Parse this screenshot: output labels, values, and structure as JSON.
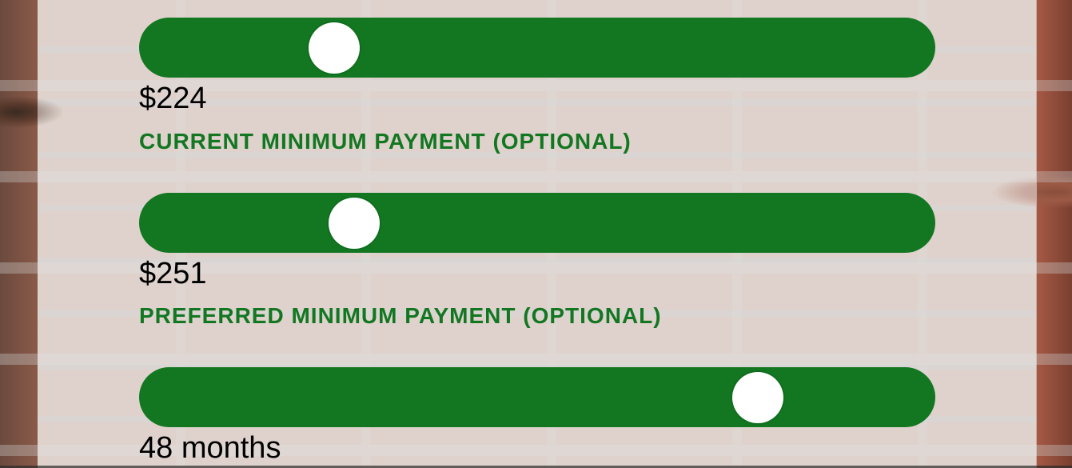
{
  "colors": {
    "accent": "#137722",
    "thumb": "#ffffff",
    "text": "#000000"
  },
  "sliders": [
    {
      "value_text": "$224",
      "fraction": 0.245,
      "label": "CURRENT MINIMUM PAYMENT (OPTIONAL)"
    },
    {
      "value_text": "$251",
      "fraction": 0.27,
      "label": "PREFERRED MINIMUM PAYMENT (OPTIONAL)"
    },
    {
      "value_text": "48 months",
      "fraction": 0.777,
      "label": ""
    }
  ]
}
